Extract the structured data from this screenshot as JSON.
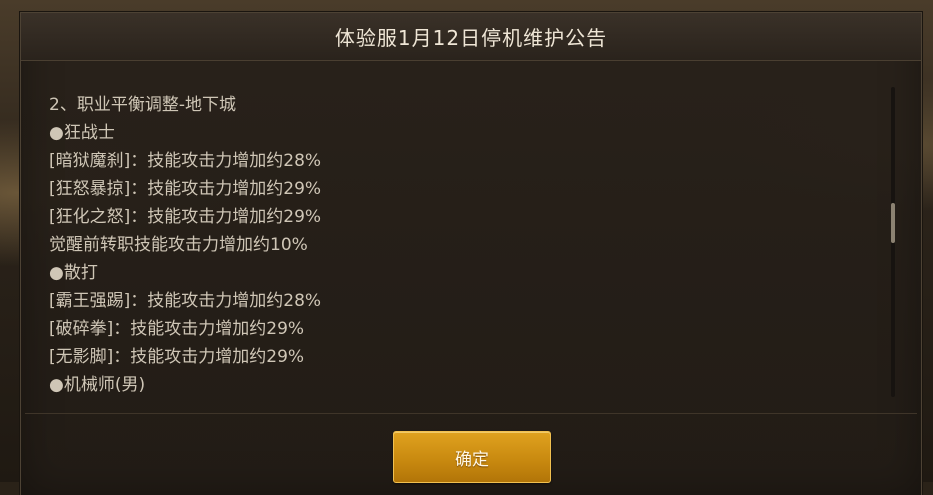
{
  "dialog": {
    "title": "体验服1月12日停机维护公告",
    "lines": [
      "2、职业平衡调整-地下城",
      "●狂战士",
      "[暗狱魔刹]：技能攻击力增加约28%",
      "[狂怒暴掠]：技能攻击力增加约29%",
      "[狂化之怒]：技能攻击力增加约29%",
      "觉醒前转职技能攻击力增加约10%",
      "●散打",
      "[霸王强踢]：技能攻击力增加约28%",
      "[破碎拳]：技能攻击力增加约29%",
      "[无影脚]：技能攻击力增加约29%",
      "●机械师(男)"
    ],
    "confirm_label": "确定"
  },
  "colors": {
    "accent_button": "#d4961a",
    "text": "#cfc6b6",
    "title_text": "#efe6d6"
  }
}
